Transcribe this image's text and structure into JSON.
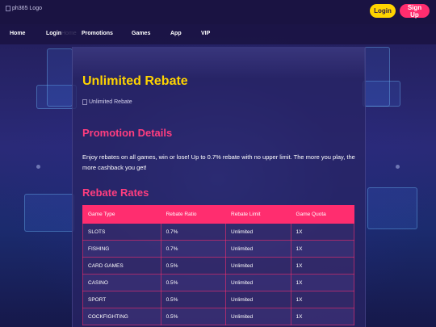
{
  "header": {
    "logo_alt": "ph365 Logo",
    "login_label": "Login",
    "signup_label": "Sign Up",
    "colors": {
      "login_bg": "#ffd400",
      "signup_bg": "#ff2d6f",
      "header_bg": "#1a1342"
    }
  },
  "nav": {
    "items": [
      {
        "label": "Home"
      },
      {
        "label": "Login"
      },
      {
        "label": "Promotions"
      },
      {
        "label": "Games"
      },
      {
        "label": "App"
      },
      {
        "label": "VIP"
      }
    ],
    "ghost_text": "Home"
  },
  "main": {
    "title": "Unlimited Rebate",
    "image_alt": "Unlimited Rebate",
    "details_heading": "Promotion Details",
    "details_text": "Enjoy rebates on all games, win or lose! Up to 0.7% rebate with no upper limit. The more you play, the more cashback you get!",
    "rates_heading": "Rebate Rates",
    "table": {
      "headers": [
        "Game Type",
        "Rebate Ratio",
        "Rebate Limit",
        "Game Quota"
      ],
      "rows": [
        [
          "SLOTS",
          "0.7%",
          "Unlimited",
          "1X"
        ],
        [
          "FISHING",
          "0.7%",
          "Unlimited",
          "1X"
        ],
        [
          "CARD GAMES",
          "0.5%",
          "Unlimited",
          "1X"
        ],
        [
          "CASINO",
          "0.5%",
          "Unlimited",
          "1X"
        ],
        [
          "SPORT",
          "0.5%",
          "Unlimited",
          "1X"
        ],
        [
          "COCKFIGHTING",
          "0.5%",
          "Unlimited",
          "1X"
        ]
      ]
    },
    "colors": {
      "title": "#ffd400",
      "heading": "#ff3d7f",
      "table_header": "#ff2d6f"
    }
  }
}
